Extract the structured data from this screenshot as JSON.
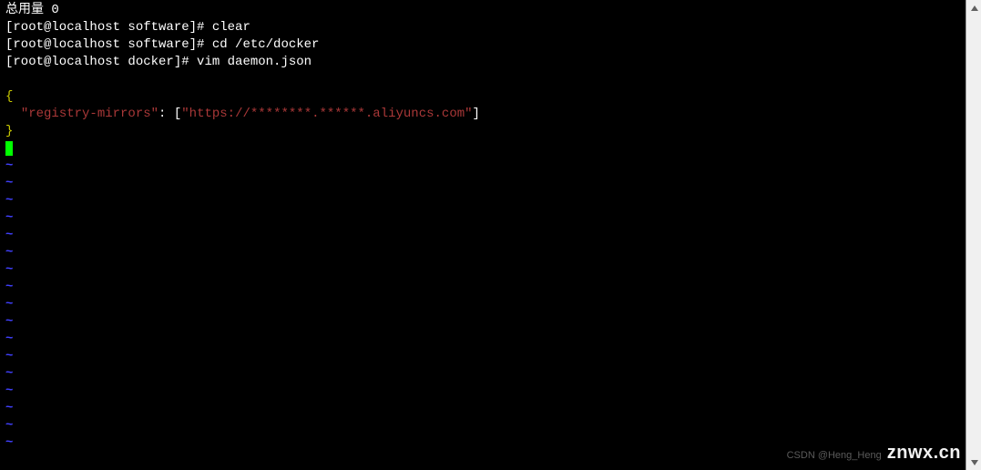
{
  "terminal": {
    "line1": "总用量 0",
    "prompt1": "[root@localhost software]# ",
    "cmd1": "clear",
    "prompt2": "[root@localhost software]# ",
    "cmd2": "cd /etc/docker",
    "prompt3": "[root@localhost docker]# ",
    "cmd3": "vim daemon.json"
  },
  "vim": {
    "brace_open": "{",
    "key_indent": "  ",
    "key_quoted": "\"registry-mirrors\"",
    "colon_bracket": ": [",
    "value_quoted": "\"https://********.******.aliyuncs.com\"",
    "close_bracket": "]",
    "brace_close": "}",
    "tilde": "~"
  },
  "watermark": {
    "csdn": "CSDN @Heng_Heng",
    "domain": "znwx.cn"
  }
}
